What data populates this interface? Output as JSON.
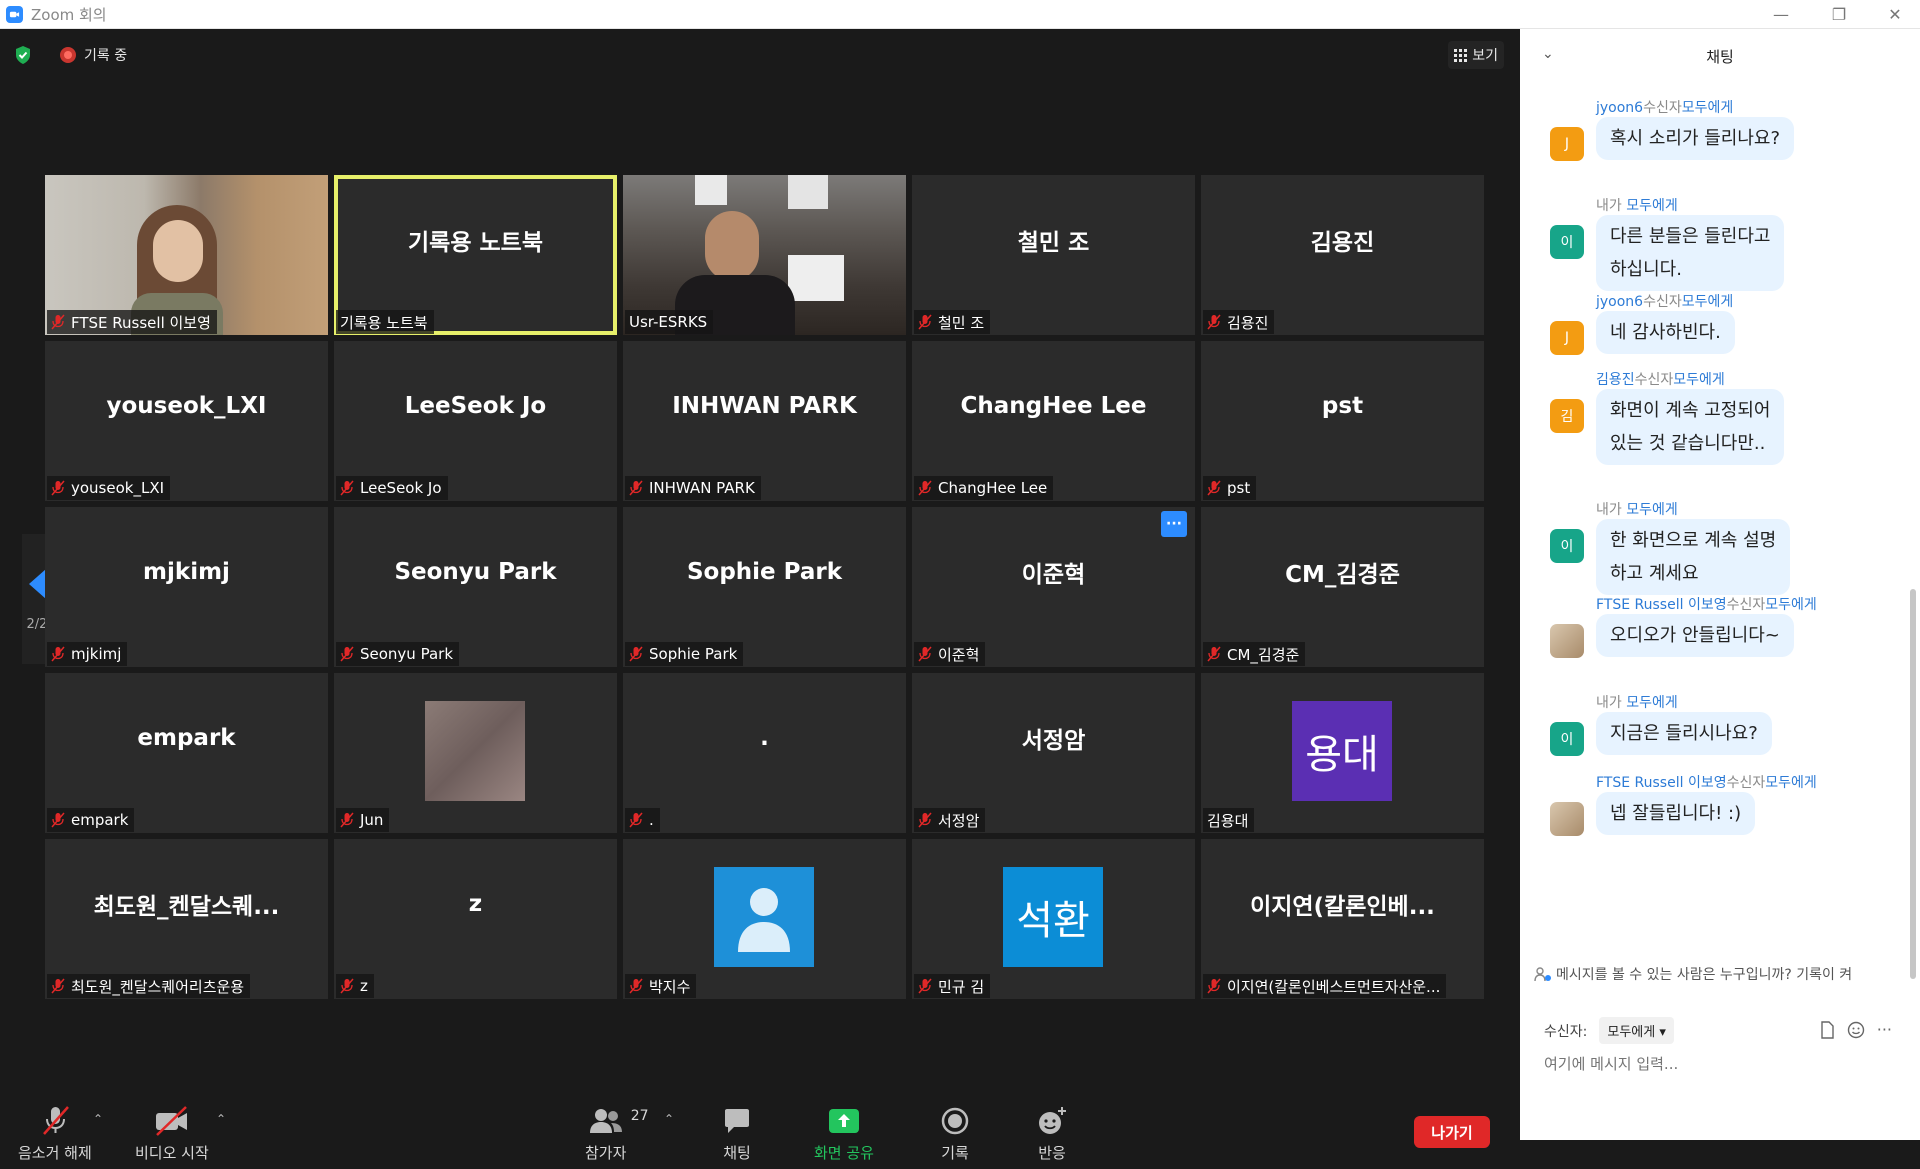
{
  "window": {
    "title": "Zoom 회의",
    "minimize": "—",
    "restore": "❐",
    "close": "✕"
  },
  "topbar": {
    "recording": "기록 중",
    "view": "보기"
  },
  "page_indicator": "2/2",
  "tiles": [
    {
      "label": "FTSE Russell 이보영",
      "muted": true,
      "kind": "video1"
    },
    {
      "big": "기록용 노트북",
      "label": "기록용 노트북",
      "muted": false,
      "active": true
    },
    {
      "label": "Usr-ESRKS",
      "muted": false,
      "kind": "video3"
    },
    {
      "big": "철민 조",
      "label": "철민 조",
      "muted": true
    },
    {
      "big": "김용진",
      "label": "김용진",
      "muted": true
    },
    {
      "big": "youseok_LXI",
      "label": "youseok_LXI",
      "muted": true
    },
    {
      "big": "LeeSeok Jo",
      "label": "LeeSeok Jo",
      "muted": true
    },
    {
      "big": "INHWAN PARK",
      "label": "INHWAN PARK",
      "muted": true
    },
    {
      "big": "ChangHee Lee",
      "label": "ChangHee Lee",
      "muted": true
    },
    {
      "big": "pst",
      "label": "pst",
      "muted": true
    },
    {
      "big": "mjkimj",
      "label": "mjkimj",
      "muted": true
    },
    {
      "big": "Seonyu Park",
      "label": "Seonyu Park",
      "muted": true
    },
    {
      "big": "Sophie Park",
      "label": "Sophie Park",
      "muted": true
    },
    {
      "big": "이준혁",
      "label": "이준혁",
      "muted": true,
      "more": "···"
    },
    {
      "big": "CM_김경준",
      "label": "CM_김경준",
      "muted": true
    },
    {
      "big": "empark",
      "label": "empark",
      "muted": true
    },
    {
      "label": "Jun",
      "muted": true,
      "kind": "photo"
    },
    {
      "big": ".",
      "label": ".",
      "muted": true
    },
    {
      "big": "서정암",
      "label": "서정암",
      "muted": true
    },
    {
      "label": "김용대",
      "muted": false,
      "avatar_text": "용대",
      "avatar_color": "#5b2fb3"
    },
    {
      "big": "최도원_켄달스퀘...",
      "label": "최도원_켄달스퀘어리츠운용",
      "muted": true
    },
    {
      "big": "z",
      "label": "z",
      "muted": true
    },
    {
      "label": "박지수",
      "muted": true,
      "avatar_person": true,
      "avatar_color": "#1e90d8"
    },
    {
      "label": "민규 김",
      "muted": true,
      "avatar_text": "석환",
      "avatar_color": "#0c8dd6"
    },
    {
      "big": "이지연(칼론인베...",
      "label": "이지연(칼론인베스트먼트자산운...",
      "muted": true
    }
  ],
  "toolbar": {
    "mute": "음소거 해제",
    "video": "비디오 시작",
    "participants": "참가자",
    "participants_count": "27",
    "chat": "채팅",
    "share": "화면 공유",
    "record": "기록",
    "reactions": "반응",
    "leave": "나가기"
  },
  "chat": {
    "title": "채팅",
    "messages": [
      {
        "sender": "jyoon6",
        "mid": "수신자",
        "to": "모두에게",
        "avatar": "J",
        "avatar_color": "#f39c12",
        "text": "혹시 소리가 들리나요?"
      },
      {
        "sender": "내가",
        "mid": " ",
        "to": "모두에게",
        "avatar": "이",
        "avatar_color": "#17a589",
        "text": "다른 분들은 들린다고\n하십니다."
      },
      {
        "sender": "jyoon6",
        "mid": "수신자",
        "to": "모두에게",
        "avatar": "J",
        "avatar_color": "#f39c12",
        "text": "네 감사하빈다."
      },
      {
        "sender": "김용진",
        "mid": "수신자",
        "to": "모두에게",
        "avatar": "김",
        "avatar_color": "#f39c12",
        "text": "화면이 계속 고정되어\n있는 것 같습니다만.."
      },
      {
        "sender": "내가",
        "mid": " ",
        "to": "모두에게",
        "avatar": "이",
        "avatar_color": "#17a589",
        "text": "한 화면으로 계속 설명\n하고 계세요"
      },
      {
        "sender": "FTSE Russell 이보영",
        "mid": "수신자",
        "to": "모두에게",
        "avatar": "",
        "avatar_color": "#c9b59a",
        "text": "오디오가 안들립니다~"
      },
      {
        "sender": "내가",
        "mid": " ",
        "to": "모두에게",
        "avatar": "이",
        "avatar_color": "#17a589",
        "text": "지금은 들리시나요?"
      },
      {
        "sender": "FTSE Russell 이보영",
        "mid": "수신자",
        "to": "모두에게",
        "avatar": "",
        "avatar_color": "#c9b59a",
        "text": "넵 잘들립니다! :)"
      }
    ],
    "notice": "메시지를 볼 수 있는 사람은 누구입니까? 기록이 켜",
    "to_label": "수신자:",
    "to_value": "모두에게 ▾",
    "input_placeholder": "여기에 메시지 입력..."
  }
}
